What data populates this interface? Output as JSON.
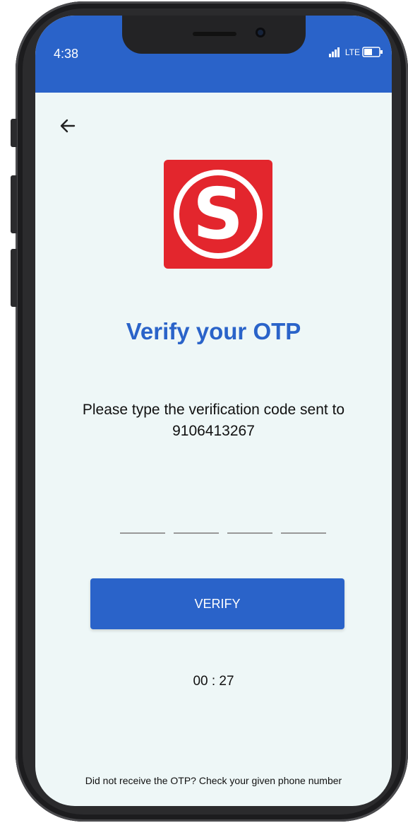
{
  "status_bar": {
    "time": "4:38",
    "network": "LTE",
    "color": "#2a63c9"
  },
  "icons": {
    "back": "arrow-left-icon",
    "signal": "signal-icon",
    "battery": "battery-icon",
    "logo": "s-logo"
  },
  "logo": {
    "letter": "S",
    "bg_color": "#e3262d"
  },
  "page": {
    "title": "Verify your OTP",
    "instruction_line1": "Please type the verification code sent to",
    "phone_number": "9106413267"
  },
  "otp": {
    "digits": [
      "",
      "",
      "",
      ""
    ]
  },
  "verify_button": {
    "label": "VERIFY"
  },
  "timer": {
    "text": "00 : 27"
  },
  "footer": {
    "text": "Did not receive the OTP? Check your given phone number"
  },
  "colors": {
    "accent": "#2a63c9",
    "background": "#eef7f7",
    "logo_red": "#e3262d"
  }
}
